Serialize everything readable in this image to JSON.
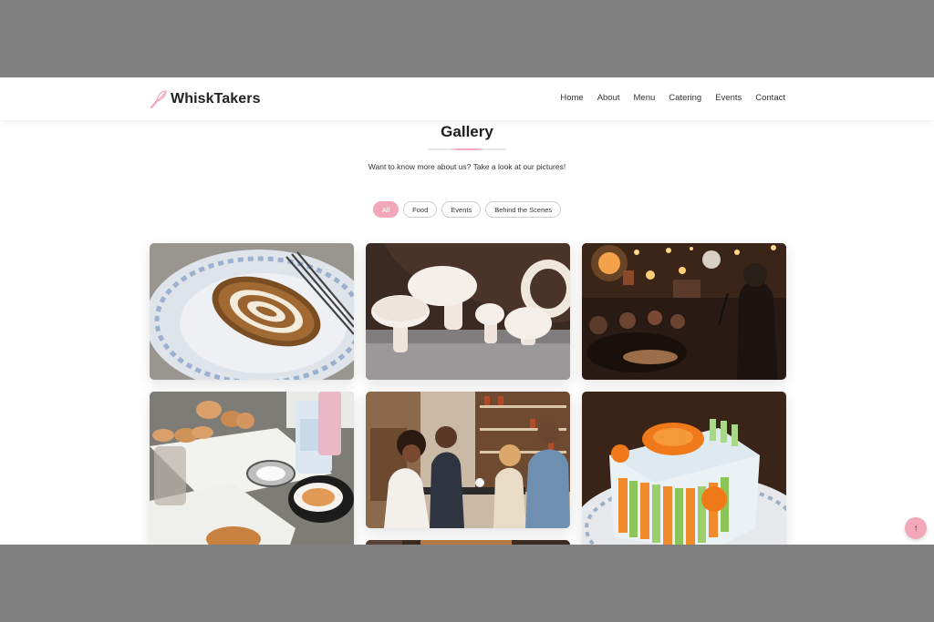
{
  "brand": {
    "name": "WhiskTakers",
    "icon": "whisk-icon",
    "accent": "#f2a7bb"
  },
  "nav": {
    "items": [
      "Home",
      "About",
      "Menu",
      "Catering",
      "Events",
      "Contact"
    ]
  },
  "gallery": {
    "title": "Gallery",
    "subtitle": "Want to know more about us? Take a look at our pictures!",
    "filters": [
      "All",
      "Food",
      "Events",
      "Behind the Scenes"
    ],
    "active_filter": "All"
  },
  "scroll_top": {
    "icon": "arrow-up-icon",
    "glyph": "↑"
  }
}
